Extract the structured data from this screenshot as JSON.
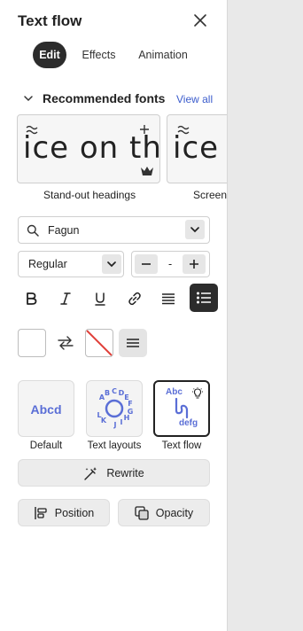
{
  "panel": {
    "title": "Text flow",
    "tabs": [
      {
        "label": "Edit",
        "active": true
      },
      {
        "label": "Effects",
        "active": false
      },
      {
        "label": "Animation",
        "active": false
      }
    ]
  },
  "recommended": {
    "heading": "Recommended fonts",
    "view_all": "View all",
    "cards": [
      {
        "sample": "ice on the",
        "label": "Stand-out headings"
      },
      {
        "sample": "ice",
        "label": "Screen-"
      }
    ]
  },
  "font": {
    "search_value": "Fagun",
    "weight": "Regular",
    "size_value": "-"
  },
  "layouts": {
    "items": [
      {
        "label": "Default",
        "preview": "Abcd"
      },
      {
        "label": "Text layouts",
        "preview": "ABCDEFGHIJKL"
      },
      {
        "label": "Text flow",
        "preview_top": "Abc",
        "preview_bottom": "defg"
      }
    ]
  },
  "actions": {
    "rewrite": "Rewrite",
    "position": "Position",
    "opacity": "Opacity"
  },
  "colors": {
    "accent": "#5a6ed6",
    "dark": "#2c2c2c",
    "link": "#3b5ccc",
    "strike": "#e0403a"
  }
}
